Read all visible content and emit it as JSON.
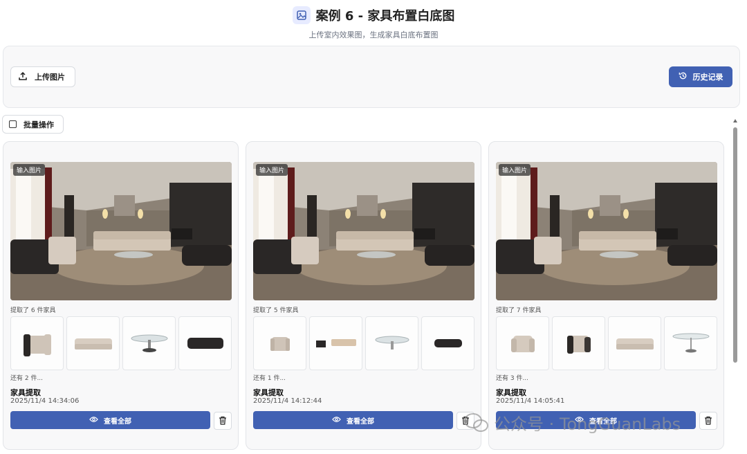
{
  "header": {
    "title": "案例 6 - 家具布置白底图",
    "subtitle": "上传室内效果图，生成家具白底布置图"
  },
  "toolbar": {
    "upload_label": "上传图片",
    "history_label": "历史记录"
  },
  "batch": {
    "label": "批量操作"
  },
  "cards": [
    {
      "badge": "输入图片",
      "extract_count": "提取了 6 件家具",
      "thumb_icons": [
        "armchair-icon",
        "sofa-icon",
        "coffee-table-icon",
        "ottoman-icon"
      ],
      "more": "还有 2 件...",
      "title": "家具提取",
      "time": "2025/11/4 14:34:06",
      "view_label": "查看全部"
    },
    {
      "badge": "输入图片",
      "extract_count": "提取了 5 件家具",
      "thumb_icons": [
        "armchair-icon",
        "sofa-set-icon",
        "coffee-table-icon",
        "ottoman-icon"
      ],
      "more": "还有 1 件...",
      "title": "家具提取",
      "time": "2025/11/4 14:12:44",
      "view_label": "查看全部"
    },
    {
      "badge": "输入图片",
      "extract_count": "提取了 7 件家具",
      "thumb_icons": [
        "armchair-icon",
        "armchair-icon",
        "sofa-icon",
        "coffee-table-icon"
      ],
      "more": "还有 3 件...",
      "title": "家具提取",
      "time": "2025/11/4 14:05:41",
      "view_label": "查看全部"
    }
  ],
  "watermark": {
    "text": "公众号 · TongGuanLabs"
  },
  "colors": {
    "accent": "#4161b3",
    "card_bg": "#f8f8f9",
    "border": "#e2e4e8"
  }
}
